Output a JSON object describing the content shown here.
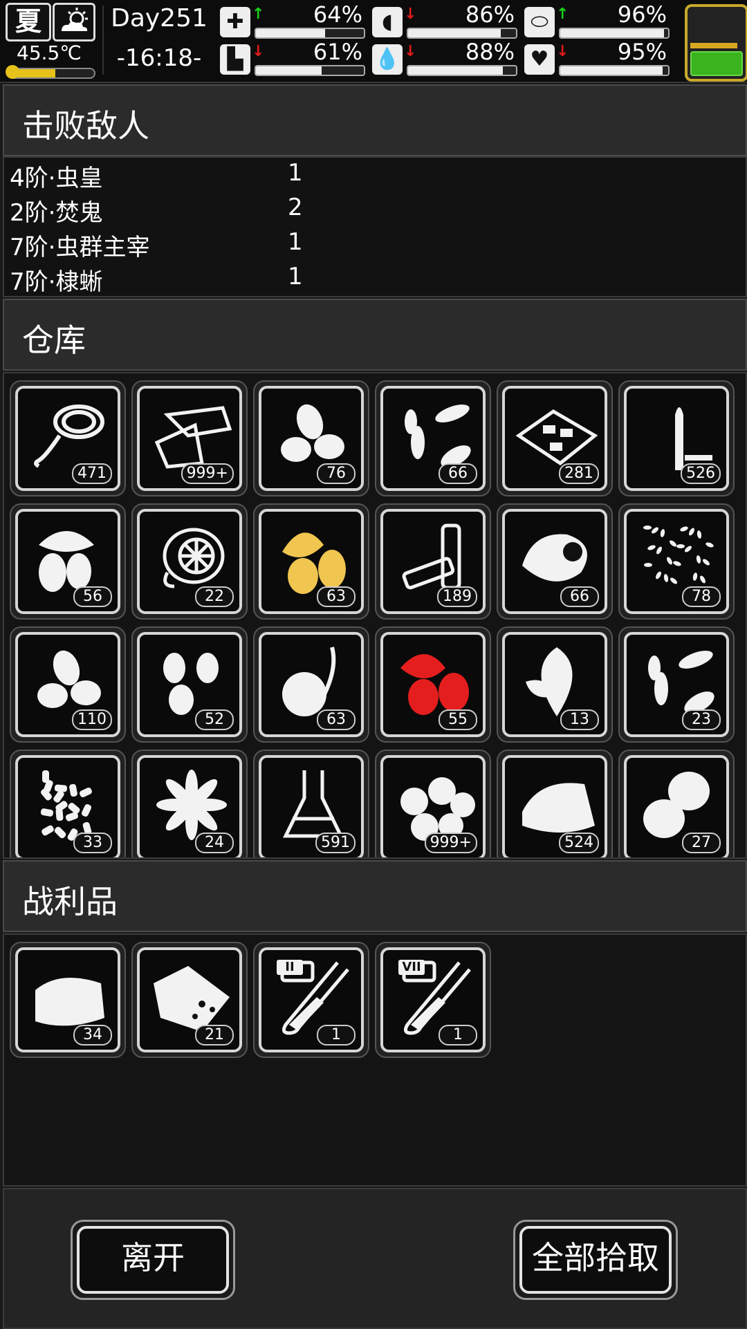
{
  "hud": {
    "season": "夏",
    "weather_icon": "partly-cloudy-icon",
    "temperature": "45.5℃",
    "temperature_level": 0.55,
    "day": "Day251",
    "time": "-16:18-",
    "stats": [
      {
        "icon": "medkit-icon",
        "trend": "up",
        "value": "64%",
        "level": 0.64
      },
      {
        "icon": "stomach-icon",
        "trend": "down",
        "value": "86%",
        "level": 0.86
      },
      {
        "icon": "pill-icon",
        "trend": "up",
        "value": "96%",
        "level": 0.96
      },
      {
        "icon": "boot-icon",
        "trend": "down",
        "value": "61%",
        "level": 0.61
      },
      {
        "icon": "water-drop-icon",
        "trend": "down",
        "value": "88%",
        "level": 0.88
      },
      {
        "icon": "heart-icon",
        "trend": "down",
        "value": "95%",
        "level": 0.95
      }
    ],
    "energy_icon": "battery-icon"
  },
  "sections": {
    "enemies_title": "击败敌人",
    "storage_title": "仓库",
    "loot_title": "战利品"
  },
  "enemies": [
    {
      "name": "4阶·虫皇",
      "count": "1"
    },
    {
      "name": "2阶·焚鬼",
      "count": "2"
    },
    {
      "name": "7阶·虫群主宰",
      "count": "1"
    },
    {
      "name": "7阶·棣蜥",
      "count": "1"
    }
  ],
  "storage": [
    {
      "icon": "rope-icon",
      "count": "471"
    },
    {
      "icon": "paper-icon",
      "count": "999+"
    },
    {
      "icon": "almond-icon",
      "count": "76"
    },
    {
      "icon": "seeds-icon",
      "count": "66"
    },
    {
      "icon": "cookie-tray-icon",
      "count": "281"
    },
    {
      "icon": "bullet-icon",
      "count": "526"
    },
    {
      "icon": "cocoa-plant-icon",
      "count": "56"
    },
    {
      "icon": "lemon-slice-icon",
      "count": "22"
    },
    {
      "icon": "golden-cocoa-icon",
      "count": "63"
    },
    {
      "icon": "battery-cells-icon",
      "count": "189"
    },
    {
      "icon": "meat-icon",
      "count": "66"
    },
    {
      "icon": "sesame-icon",
      "count": "78"
    },
    {
      "icon": "pumpkin-seed-icon",
      "count": "110"
    },
    {
      "icon": "peanut-icon",
      "count": "52"
    },
    {
      "icon": "onion-sprout-icon",
      "count": "63"
    },
    {
      "icon": "red-cocoa-icon",
      "count": "55"
    },
    {
      "icon": "mint-leaf-icon",
      "count": "13"
    },
    {
      "icon": "sunflower-seed-icon",
      "count": "23"
    },
    {
      "icon": "rice-icon",
      "count": "33"
    },
    {
      "icon": "star-anise-icon",
      "count": "24"
    },
    {
      "icon": "flask-icon",
      "count": "591"
    },
    {
      "icon": "chestnut-icon",
      "count": "999+"
    },
    {
      "icon": "cloth-icon",
      "count": "524"
    },
    {
      "icon": "potato-icon",
      "count": "27"
    }
  ],
  "loot": [
    {
      "icon": "folded-cloth-icon",
      "count": "34"
    },
    {
      "icon": "ore-sack-icon",
      "count": "21"
    },
    {
      "icon": "test-tube-ii-icon",
      "count": "1",
      "tier": "II"
    },
    {
      "icon": "test-tube-vii-icon",
      "count": "1",
      "tier": "VII"
    }
  ],
  "buttons": {
    "leave": "离开",
    "pick_all": "全部拾取"
  },
  "colors": {
    "up_arrow": "#18d018",
    "down_arrow": "#e21a1a",
    "energy_border": "#c8a92a",
    "energy_fill": "#3bb31f",
    "temperature": "#e6c21a",
    "golden_item": "#f0c550",
    "red_item": "#e41e1e"
  }
}
